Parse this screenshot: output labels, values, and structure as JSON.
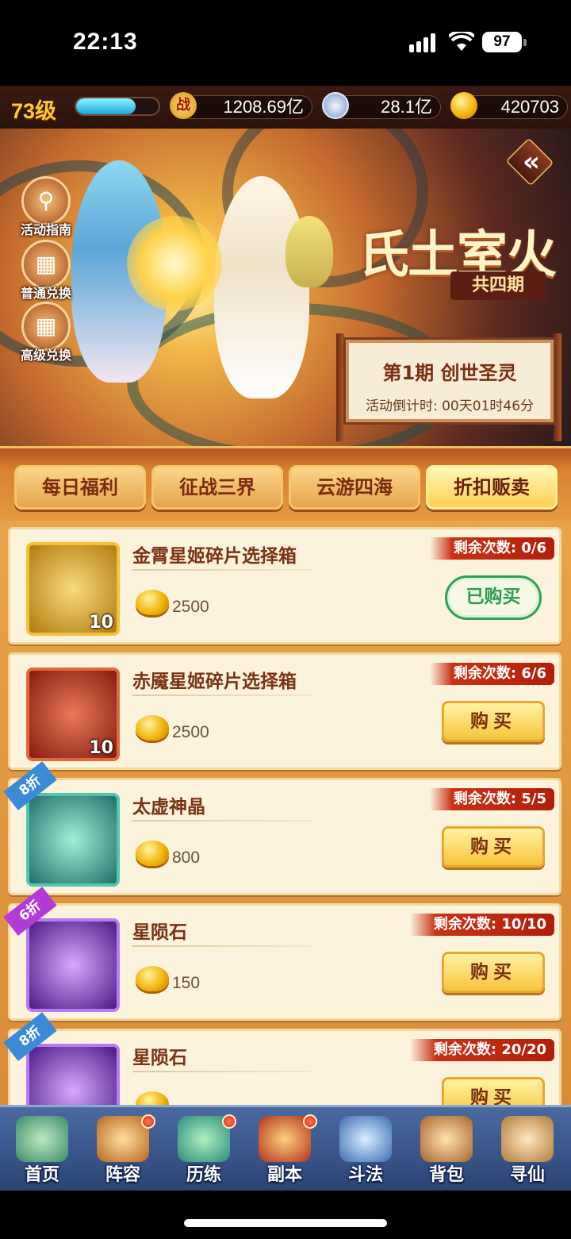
{
  "status_bar": {
    "time": "22:13",
    "battery": "97"
  },
  "resources": {
    "level": "73级",
    "exp_fraction": 0.72,
    "power_icon": "战",
    "power_value": "1208.69亿",
    "silver_value": "28.1亿",
    "gold_value": "420703"
  },
  "banner": {
    "side_buttons": [
      {
        "label": "活动指南",
        "icon": "magnifier-icon"
      },
      {
        "label": "普通兑换",
        "icon": "gift-box-icon"
      },
      {
        "label": "高级兑换",
        "icon": "premium-gift-icon"
      }
    ],
    "title": "氏土室火",
    "subtitle": "共四期",
    "stage": "第1期  创世圣灵",
    "countdown": "活动倒计时: 00天01时46分"
  },
  "tabs": [
    {
      "label": "每日福利",
      "active": false
    },
    {
      "label": "征战三界",
      "active": false
    },
    {
      "label": "云游四海",
      "active": false
    },
    {
      "label": "折扣贩卖",
      "active": true
    }
  ],
  "shop_items": [
    {
      "name": "金霄星姬碎片选择箱",
      "price": "2500",
      "remaining": "剩余次数: 0/6",
      "count": "10",
      "discount": "",
      "button": "已购买",
      "bought": true,
      "icon_color": "#e3b21c"
    },
    {
      "name": "赤魇星姬碎片选择箱",
      "price": "2500",
      "remaining": "剩余次数: 6/6",
      "count": "10",
      "discount": "",
      "button": "购买",
      "bought": false,
      "icon_color": "#c8301e"
    },
    {
      "name": "太虚神晶",
      "price": "800",
      "remaining": "剩余次数: 5/5",
      "count": "",
      "discount": "8折",
      "button": "购买",
      "bought": false,
      "icon_color": "#1f8f86"
    },
    {
      "name": "星陨石",
      "price": "150",
      "remaining": "剩余次数: 10/10",
      "count": "",
      "discount": "6折",
      "button": "购买",
      "bought": false,
      "icon_color": "#6a2aa8"
    },
    {
      "name": "星陨石",
      "price": "",
      "remaining": "剩余次数: 20/20",
      "count": "",
      "discount": "8折",
      "button": "购买",
      "bought": false,
      "icon_color": "#6a2aa8"
    }
  ],
  "bottom_nav": [
    {
      "label": "首页",
      "badge": false
    },
    {
      "label": "阵容",
      "badge": true
    },
    {
      "label": "历练",
      "badge": true
    },
    {
      "label": "副本",
      "badge": true
    },
    {
      "label": "斗法",
      "badge": false
    },
    {
      "label": "背包",
      "badge": false
    },
    {
      "label": "寻仙",
      "badge": false
    }
  ]
}
